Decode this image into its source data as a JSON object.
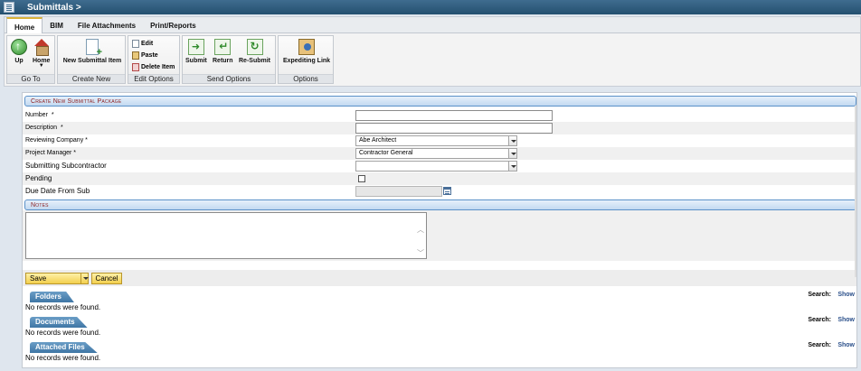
{
  "window": {
    "title": "Submittals >"
  },
  "ribbon": {
    "tabs": [
      "Home",
      "BIM",
      "File Attachments",
      "Print/Reports"
    ],
    "groups": {
      "goto": {
        "label": "Go To",
        "up": "Up",
        "home": "Home"
      },
      "create_new": {
        "label": "Create New",
        "new_item": "New Submittal Item"
      },
      "edit_options": {
        "label": "Edit Options",
        "edit": "Edit",
        "paste": "Paste",
        "delete": "Delete Item"
      },
      "send_options": {
        "label": "Send Options",
        "submit": "Submit",
        "return": "Return",
        "resubmit": "Re-Submit"
      },
      "options": {
        "label": "Options",
        "expediting": "Expediting Link"
      }
    }
  },
  "form": {
    "section_title": "Create New Submittal Package",
    "number_label": "Number",
    "description_label": "Description",
    "reviewing_company_label": "Reviewing Company *",
    "reviewing_company_value": "Abe Architect",
    "project_manager_label": "Project Manager *",
    "project_manager_value": "Contractor General",
    "subcontractor_label": "Submitting Subcontractor",
    "subcontractor_value": "",
    "pending_label": "Pending",
    "due_date_label": "Due Date From Sub",
    "required_marker": "*",
    "notes_title": "Notes"
  },
  "actions": {
    "save": "Save",
    "cancel": "Cancel"
  },
  "lists": [
    {
      "title": "Folders",
      "empty": "No records were found.",
      "search": "Search:",
      "show": "Show"
    },
    {
      "title": "Documents",
      "empty": "No records were found.",
      "search": "Search:",
      "show": "Show"
    },
    {
      "title": "Attached Files",
      "empty": "No records were found.",
      "search": "Search:",
      "show": "Show"
    }
  ],
  "colors": {
    "titlebar": "#24506f",
    "section_title_text": "#8b1a1a",
    "button_yellow": "#f2cf4e"
  }
}
